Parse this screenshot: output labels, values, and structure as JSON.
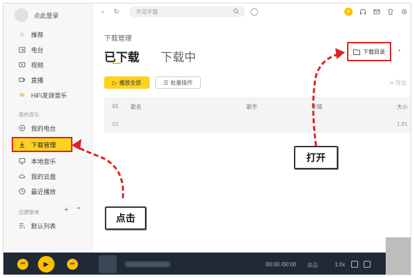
{
  "app": {
    "login_label": "点此登录",
    "search_placeholder": "不见不散"
  },
  "sidebar": {
    "items": [
      {
        "label": "推荐",
        "icon": "star-icon"
      },
      {
        "label": "电台",
        "icon": "radio-icon"
      },
      {
        "label": "视频",
        "icon": "video-icon"
      },
      {
        "label": "直播",
        "icon": "live-icon"
      },
      {
        "label": "HiFi发烧音乐",
        "icon": "hifi-icon"
      }
    ],
    "my_music_title": "我的音乐",
    "my_items": [
      {
        "label": "我的电台",
        "icon": "radio-icon"
      },
      {
        "label": "下载管理",
        "icon": "download-icon"
      },
      {
        "label": "本地音乐",
        "icon": "computer-icon"
      },
      {
        "label": "我的云盘",
        "icon": "cloud-icon"
      },
      {
        "label": "最近播放",
        "icon": "clock-icon"
      }
    ],
    "playlist_title": "自建歌单",
    "playlist_items": [
      {
        "label": "默认列表",
        "icon": "list-icon"
      }
    ]
  },
  "main": {
    "breadcrumb": "下载管理",
    "tab_downloaded": "已下载",
    "tab_downloading": "下载中",
    "play_all": "播放全部",
    "batch": "批量操作",
    "export": "导出",
    "download_dir": "下载目录",
    "table": {
      "headers": [
        "01",
        "歌名",
        "歌手",
        "专辑",
        "大小"
      ],
      "row": {
        "index": "01",
        "size": "1.81"
      }
    }
  },
  "player": {
    "time": "00:00 /00:00",
    "quality": "高品",
    "speed": "1.0x"
  },
  "annotations": {
    "click_label": "点击",
    "open_label": "打开"
  },
  "colors": {
    "accent": "#ffd21f",
    "highlight": "#e02020",
    "player_bg": "#1f2a36"
  }
}
